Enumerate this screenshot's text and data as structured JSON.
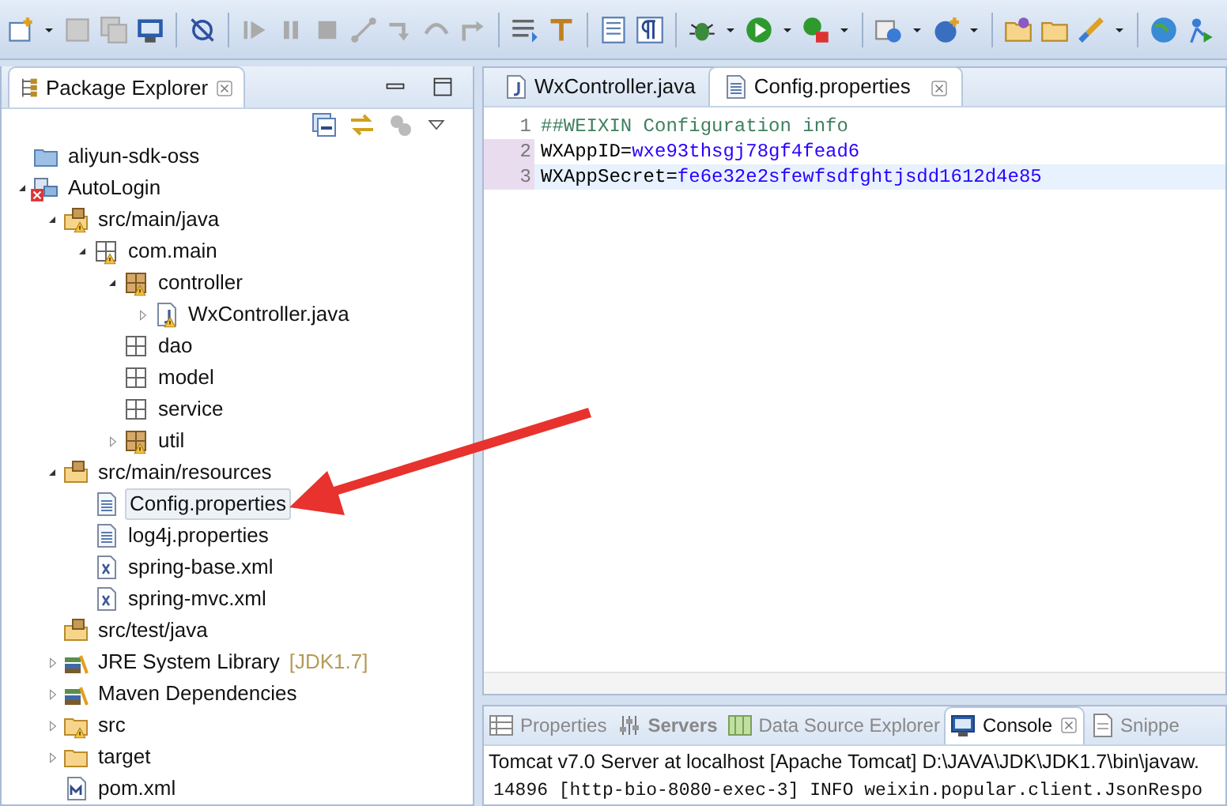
{
  "package_explorer": {
    "title": "Package Explorer",
    "tree": [
      {
        "label": "aliyun-sdk-oss",
        "kind": "project",
        "warning": false,
        "error": false,
        "selected": false
      },
      {
        "label": "AutoLogin",
        "kind": "maven-project",
        "warning": false,
        "error": true,
        "expanded": true,
        "selected": false,
        "children": [
          {
            "label": "src/main/java",
            "kind": "source-folder",
            "warning": true,
            "error": false,
            "expanded": true,
            "selected": false,
            "children": [
              {
                "label": "com.main",
                "kind": "package",
                "warning": true,
                "error": false,
                "expanded": true,
                "selected": false,
                "children": [
                  {
                    "label": "controller",
                    "kind": "package-filled",
                    "warning": true,
                    "error": false,
                    "expanded": true,
                    "selected": false,
                    "children": [
                      {
                        "label": "WxController.java",
                        "kind": "java-file",
                        "warning": true,
                        "error": false,
                        "expanded": false,
                        "selected": false
                      }
                    ]
                  },
                  {
                    "label": "dao",
                    "kind": "package",
                    "warning": false,
                    "error": false,
                    "selected": false
                  },
                  {
                    "label": "model",
                    "kind": "package",
                    "warning": false,
                    "error": false,
                    "selected": false
                  },
                  {
                    "label": "service",
                    "kind": "package",
                    "warning": false,
                    "error": false,
                    "selected": false
                  },
                  {
                    "label": "util",
                    "kind": "package-filled",
                    "warning": true,
                    "error": false,
                    "expanded": false,
                    "selected": false
                  }
                ]
              }
            ]
          },
          {
            "label": "src/main/resources",
            "kind": "source-folder",
            "warning": false,
            "error": false,
            "expanded": true,
            "selected": false,
            "children": [
              {
                "label": "Config.properties",
                "kind": "text-file",
                "warning": false,
                "error": false,
                "selected": true
              },
              {
                "label": "log4j.properties",
                "kind": "text-file",
                "warning": false,
                "error": false,
                "selected": false
              },
              {
                "label": "spring-base.xml",
                "kind": "xml-file",
                "warning": false,
                "error": false,
                "selected": false
              },
              {
                "label": "spring-mvc.xml",
                "kind": "xml-file",
                "warning": false,
                "error": false,
                "selected": false
              }
            ]
          },
          {
            "label": "src/test/java",
            "kind": "source-folder",
            "warning": false,
            "error": false,
            "selected": false
          },
          {
            "label": "JRE System Library",
            "decoration": "[JDK1.7]",
            "kind": "library",
            "warning": false,
            "error": false,
            "expanded": false,
            "selected": false
          },
          {
            "label": "Maven Dependencies",
            "kind": "library",
            "warning": false,
            "error": false,
            "expanded": false,
            "selected": false
          },
          {
            "label": "src",
            "kind": "folder",
            "warning": true,
            "error": false,
            "expanded": false,
            "selected": false
          },
          {
            "label": "target",
            "kind": "folder",
            "warning": false,
            "error": false,
            "expanded": false,
            "selected": false
          },
          {
            "label": "pom.xml",
            "kind": "maven-file",
            "warning": false,
            "error": false,
            "selected": false
          }
        ]
      }
    ]
  },
  "editor": {
    "tabs": [
      {
        "label": "WxController.java",
        "kind": "java-file",
        "selected": false
      },
      {
        "label": "Config.properties",
        "kind": "text-file",
        "selected": true
      }
    ],
    "lines": [
      {
        "number": "1",
        "kind": "comment",
        "text": "##WEIXIN Configuration info",
        "changed": false,
        "current": false
      },
      {
        "number": "2",
        "kind": "property",
        "key": "WXAppID=",
        "value": "wxe93thsgj78gf4fead6",
        "changed": true,
        "current": false
      },
      {
        "number": "3",
        "kind": "property",
        "key": "WXAppSecret=",
        "value": "fe6e32e2sfewfsdfghtjsdd1612d4e85",
        "changed": true,
        "current": true
      }
    ]
  },
  "bottom_panel": {
    "tabs": [
      {
        "label": "Properties",
        "kind": "table",
        "selected": false,
        "bold": false
      },
      {
        "label": "Servers",
        "kind": "servers",
        "selected": false,
        "bold": true
      },
      {
        "label": "Data Source Explorer",
        "kind": "map",
        "selected": false,
        "bold": false
      },
      {
        "label": "Console",
        "kind": "monitor",
        "selected": true,
        "bold": false
      },
      {
        "label": "Snippe",
        "kind": "snippet",
        "selected": false,
        "bold": false
      }
    ],
    "console": {
      "header": "Tomcat v7.0 Server at localhost [Apache Tomcat] D:\\JAVA\\JDK\\JDK1.7\\bin\\javaw.",
      "lines": [
        "14896 [http-bio-8080-exec-3] INFO  weixin.popular.client.JsonRespo"
      ]
    }
  }
}
